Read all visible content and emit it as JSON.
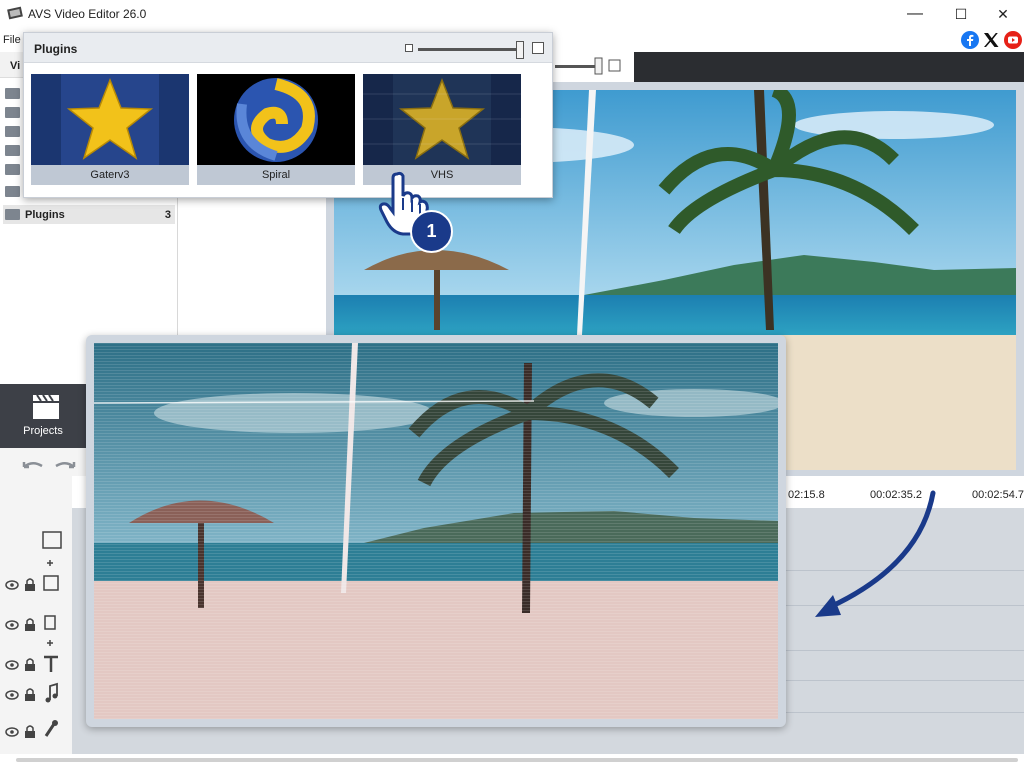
{
  "window": {
    "title": "AVS Video Editor 26.0",
    "minimize": "—",
    "maximize": "☐",
    "close": "✕"
  },
  "menu": {
    "file": "File"
  },
  "left_panel": {
    "header": "Vi",
    "plugins_label": "Plugins",
    "plugins_count": "3"
  },
  "plugins_popup": {
    "title": "Plugins",
    "tiles": [
      {
        "label": "Gaterv3"
      },
      {
        "label": "Spiral"
      },
      {
        "label": "VHS"
      }
    ]
  },
  "step_badge": "1",
  "nav": {
    "projects": "Projects"
  },
  "timeline": {
    "timecodes": [
      "02:15.8",
      "00:02:35.2",
      "00:02:54.7"
    ]
  },
  "colors": {
    "accent": "#1a3a8a",
    "tile_label_bg": "#bfc8d4",
    "projects_bg": "#3d4047",
    "facebook": "#1877f2",
    "youtube": "#e62117"
  }
}
